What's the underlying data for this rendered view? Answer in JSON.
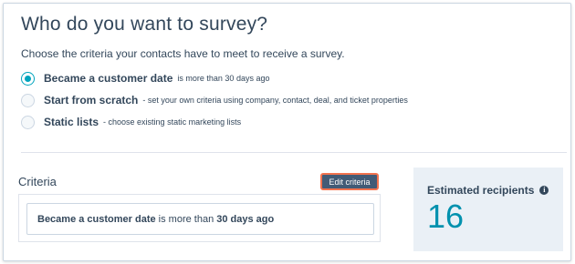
{
  "title": "Who do you want to survey?",
  "subtitle": "Choose the criteria your contacts have to meet to receive a survey.",
  "options": [
    {
      "label": "Became a customer date",
      "desc": "is more than 30 days ago",
      "checked": true
    },
    {
      "label": "Start from scratch",
      "desc": "- set your own criteria using company, contact, deal, and ticket properties",
      "checked": false
    },
    {
      "label": "Static lists",
      "desc": "- choose existing static marketing lists",
      "checked": false
    }
  ],
  "criteria": {
    "heading": "Criteria",
    "edit_label": "Edit criteria",
    "property": "Became a customer date",
    "operator": " is more than ",
    "value": "30 days ago"
  },
  "recipients": {
    "label": "Estimated recipients",
    "count": "16"
  },
  "colors": {
    "accent": "#00a4bd",
    "count": "#0091ae",
    "button": "#425b76",
    "highlight": "#f2734f"
  }
}
